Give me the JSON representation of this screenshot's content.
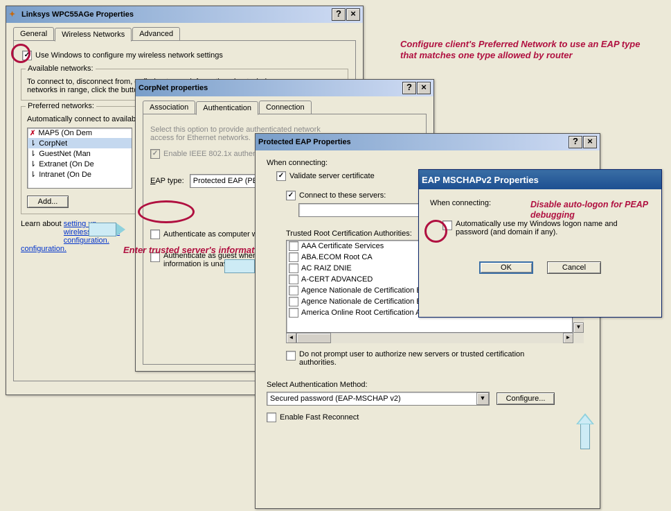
{
  "annotations": {
    "top_right": "Configure client's Preferred Network to use an EAP type that matches one type allowed by router",
    "enter_trusted": "Enter trusted server's information here",
    "disable_auto": "Disable auto-logon for PEAP debugging",
    "eap_type_label": "EAP type:"
  },
  "win1": {
    "title": "Linksys WPC55AGe Properties",
    "tabs": [
      "General",
      "Wireless Networks",
      "Advanced"
    ],
    "use_windows_cfg": "Use Windows to configure my wireless network settings",
    "group_available": "Available networks:",
    "available_text": "To connect to, disconnect from, or find out more information about wireless networks in range, click the button below.",
    "group_preferred": "Preferred networks:",
    "preferred_text": "Automatically connect to available networks in the order listed below:",
    "networks": [
      {
        "name": "MAP5 (On Dem",
        "failed": true
      },
      {
        "name": "CorpNet",
        "selected": true
      },
      {
        "name": "GuestNet (Man"
      },
      {
        "name": "Extranet (On De"
      },
      {
        "name": "Intranet (On De"
      }
    ],
    "btn_add": "Add...",
    "learn_about": "Learn about ",
    "learn_link": "setting up wireless network configuration."
  },
  "win2": {
    "title": "CorpNet properties",
    "tabs": [
      "Association",
      "Authentication",
      "Connection"
    ],
    "select_option_text": "Select this option to provide authenticated network access for Ethernet networks.",
    "enable_8021x": "Enable IEEE 802.1x authentication",
    "eap_type_label": "EAP type:",
    "eap_type_value": "Protected EAP (PEAP)",
    "auth_as_computer": "Authenticate as computer when computer information is available",
    "auth_as_guest": "Authenticate as guest when user or computer information is unavailable"
  },
  "win3": {
    "title": "Protected EAP Properties",
    "when_connecting": "When connecting:",
    "validate_server": "Validate server certificate",
    "connect_servers": "Connect to these servers:",
    "trusted_root_label": "Trusted Root Certification Authorities:",
    "cas": [
      "AAA Certificate Services",
      "ABA.ECOM Root CA",
      "AC RAIZ DNIE",
      "A-CERT ADVANCED",
      "Agence Nationale de Certification Electronique",
      "Agence Nationale de Certification Electronique",
      "America Online Root Certification Authority 1"
    ],
    "no_prompt": "Do not prompt user to authorize new servers or trusted certification authorities.",
    "select_auth_method": "Select Authentication Method:",
    "auth_method_value": "Secured password (EAP-MSCHAP v2)",
    "configure_btn": "Configure...",
    "fast_reconnect": "Enable Fast Reconnect"
  },
  "win4": {
    "title": "EAP MSCHAPv2 Properties",
    "when_connecting": "When connecting:",
    "auto_logon": "Automatically use my Windows logon name and password (and domain if any).",
    "ok": "OK",
    "cancel": "Cancel"
  }
}
